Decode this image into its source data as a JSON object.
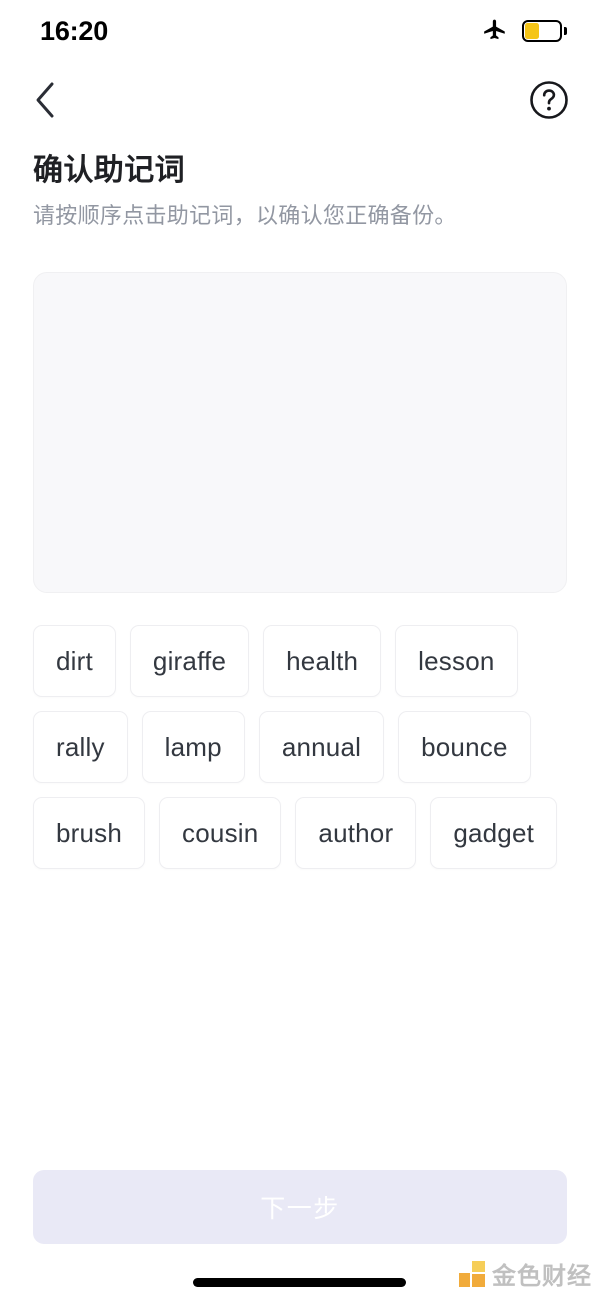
{
  "status_bar": {
    "time": "16:20",
    "airplane_icon": "airplane-mode-icon",
    "battery_icon": "battery-low-power-icon",
    "battery_color": "#f5c518"
  },
  "nav_bar": {
    "back_icon": "chevron-left-icon",
    "help_icon": "question-mark-circle-icon"
  },
  "heading": {
    "title": "确认助记词",
    "subtitle": "请按顺序点击助记词，以确认您正确备份。"
  },
  "answer_panel": {
    "selected_words": [],
    "background": "#f8f8fa"
  },
  "word_pool": {
    "words": [
      "dirt",
      "giraffe",
      "health",
      "lesson",
      "rally",
      "lamp",
      "annual",
      "bounce",
      "brush",
      "cousin",
      "author",
      "gadget"
    ]
  },
  "footer": {
    "next_label": "下一步",
    "next_enabled": false,
    "next_background": "#e9e9f6",
    "next_text_color": "#ffffff"
  },
  "watermark": {
    "text": "金色财经",
    "logo_color": "#f0a020"
  }
}
